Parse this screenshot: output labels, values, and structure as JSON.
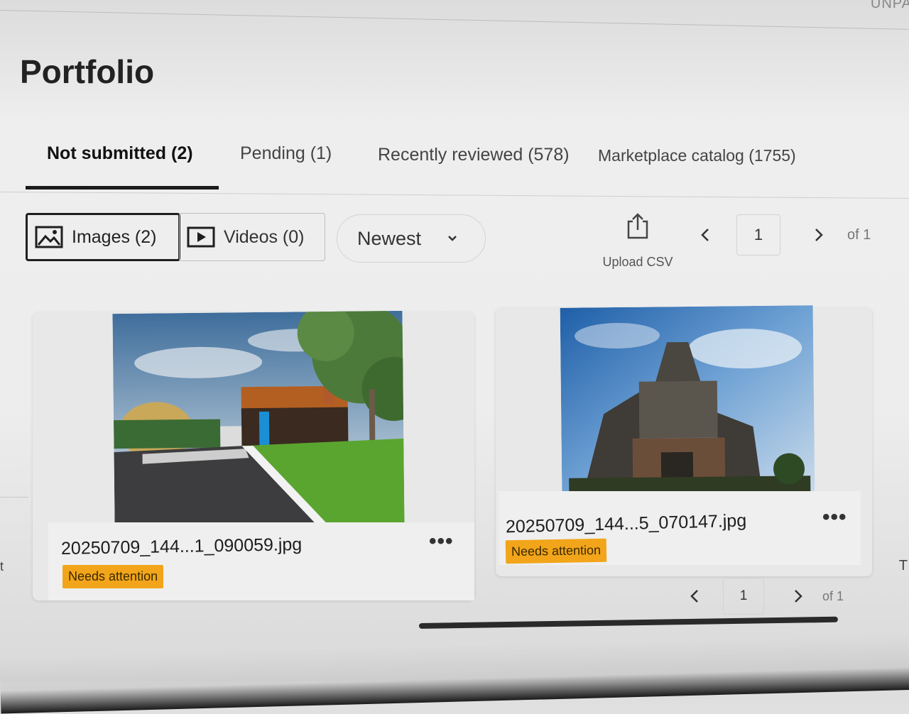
{
  "header": {
    "title": "Portfolio",
    "corner_text": "UNPA"
  },
  "tabs": [
    {
      "label": "Not submitted (2)",
      "active": true
    },
    {
      "label": "Pending (1)",
      "active": false
    },
    {
      "label": "Recently reviewed (578)",
      "active": false
    },
    {
      "label": "Marketplace catalog (1755)",
      "active": false
    }
  ],
  "filters": {
    "images_label": "Images (2)",
    "videos_label": "Videos (0)",
    "sort_value": "Newest"
  },
  "toolbar": {
    "upload_label": "Upload CSV"
  },
  "pagination_top": {
    "page": "1",
    "of_label": "of 1"
  },
  "pagination_bottom": {
    "page": "1",
    "of_label": "of 1"
  },
  "items": [
    {
      "filename": "20250709_144...1_090059.jpg",
      "status": "Needs attention",
      "thumbnail": "street-building-photo"
    },
    {
      "filename": "20250709_144...5_070147.jpg",
      "status": "Needs attention",
      "thumbnail": "temple-photo"
    }
  ],
  "edge_text": {
    "left": "it",
    "right": "T"
  },
  "colors": {
    "badge": "#f2a51a",
    "active_tab_underline": "#1b1b1b"
  }
}
